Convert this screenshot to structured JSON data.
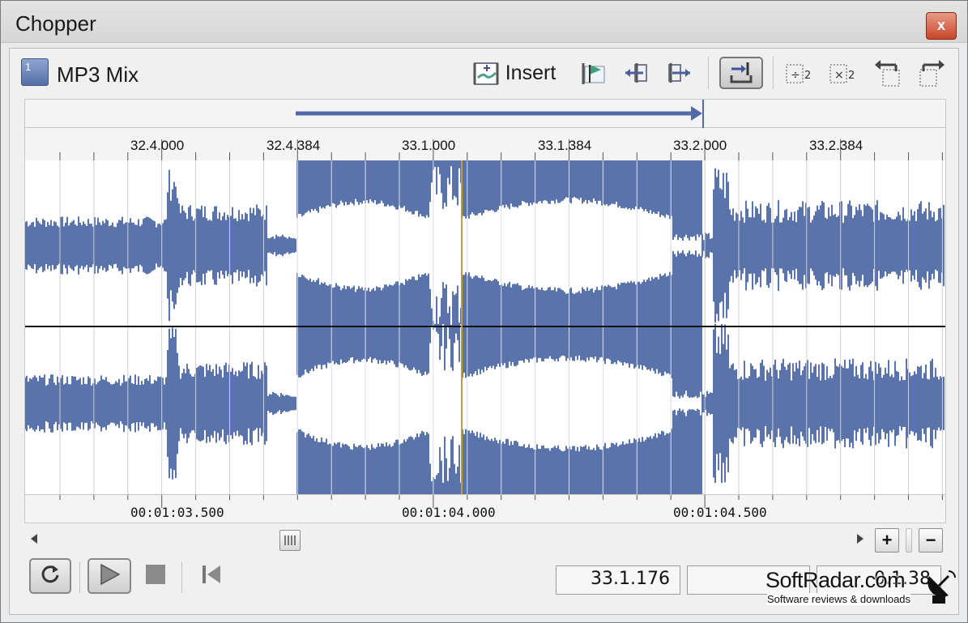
{
  "window": {
    "title": "Chopper",
    "close_label": "x"
  },
  "toolbar": {
    "track_number": "1",
    "track_name": "MP3 Mix",
    "insert_label": "Insert",
    "icons": [
      "insert-icon",
      "add-marker-icon",
      "move-left-icon",
      "move-right-icon",
      "toggle-snap-icon",
      "halve-icon",
      "double-icon",
      "shift-left-icon",
      "shift-right-icon"
    ]
  },
  "ruler_top": {
    "labels": [
      "32.4.000",
      "32.4.384",
      "33.1.000",
      "33.1.384",
      "33.2.000",
      "33.2.384"
    ]
  },
  "ruler_bottom": {
    "labels": [
      "00:01:03.500",
      "00:01:04.000",
      "00:01:04.500"
    ]
  },
  "zoom": {
    "plus": "+",
    "minus": "−"
  },
  "readouts": {
    "position": "33.1.176",
    "field2": "",
    "field3": "0.1.38"
  },
  "watermark": {
    "brand": "SoftRadar.com",
    "tagline": "Software reviews & downloads"
  },
  "colors": {
    "waveform": "#5a73aa",
    "selection": "#5a73aa",
    "accent_close": "#c8452a"
  }
}
